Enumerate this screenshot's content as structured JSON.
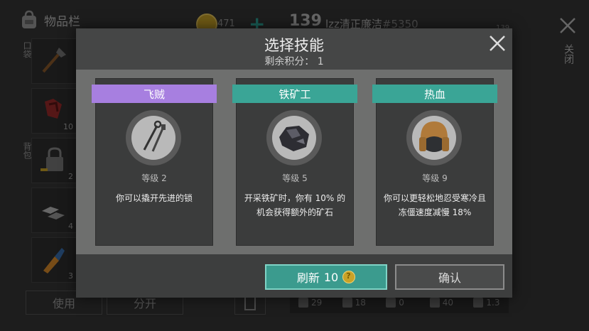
{
  "background": {
    "inventory_title": "物品栏",
    "section_pocket": "口袋",
    "section_backpack": "背包",
    "coins": "471",
    "player_level": "139",
    "player_name": "lzz清正廉洁",
    "player_id": "#5350",
    "small_level": "139",
    "close_label": "关闭",
    "use_label": "使用",
    "split_label": "分开",
    "slot_counts": [
      "",
      "10",
      "2",
      "4",
      "3"
    ],
    "stats": [
      "29",
      "18",
      "0",
      "40",
      "1.3"
    ]
  },
  "modal": {
    "title": "选择技能",
    "remaining_points": "剩余积分： 1",
    "cards": [
      {
        "name": "飞贼",
        "level": "等级 2",
        "description": "你可以撬开先进的锁",
        "ribbon_color": "#a77fe0",
        "icon": "lockpick-icon"
      },
      {
        "name": "铁矿工",
        "level": "等级 5",
        "description": "开采铁矿时，你有 10% 的机会获得额外的矿石",
        "ribbon_color": "#3aa596",
        "icon": "iron-ore-icon"
      },
      {
        "name": "热血",
        "level": "等级 9",
        "description": "你可以更轻松地忍受寒冷且冻僵速度减慢 18%",
        "ribbon_color": "#3aa596",
        "icon": "fur-hat-icon"
      }
    ],
    "refresh_label": "刷新",
    "refresh_cost": "10",
    "confirm_label": "确认"
  }
}
